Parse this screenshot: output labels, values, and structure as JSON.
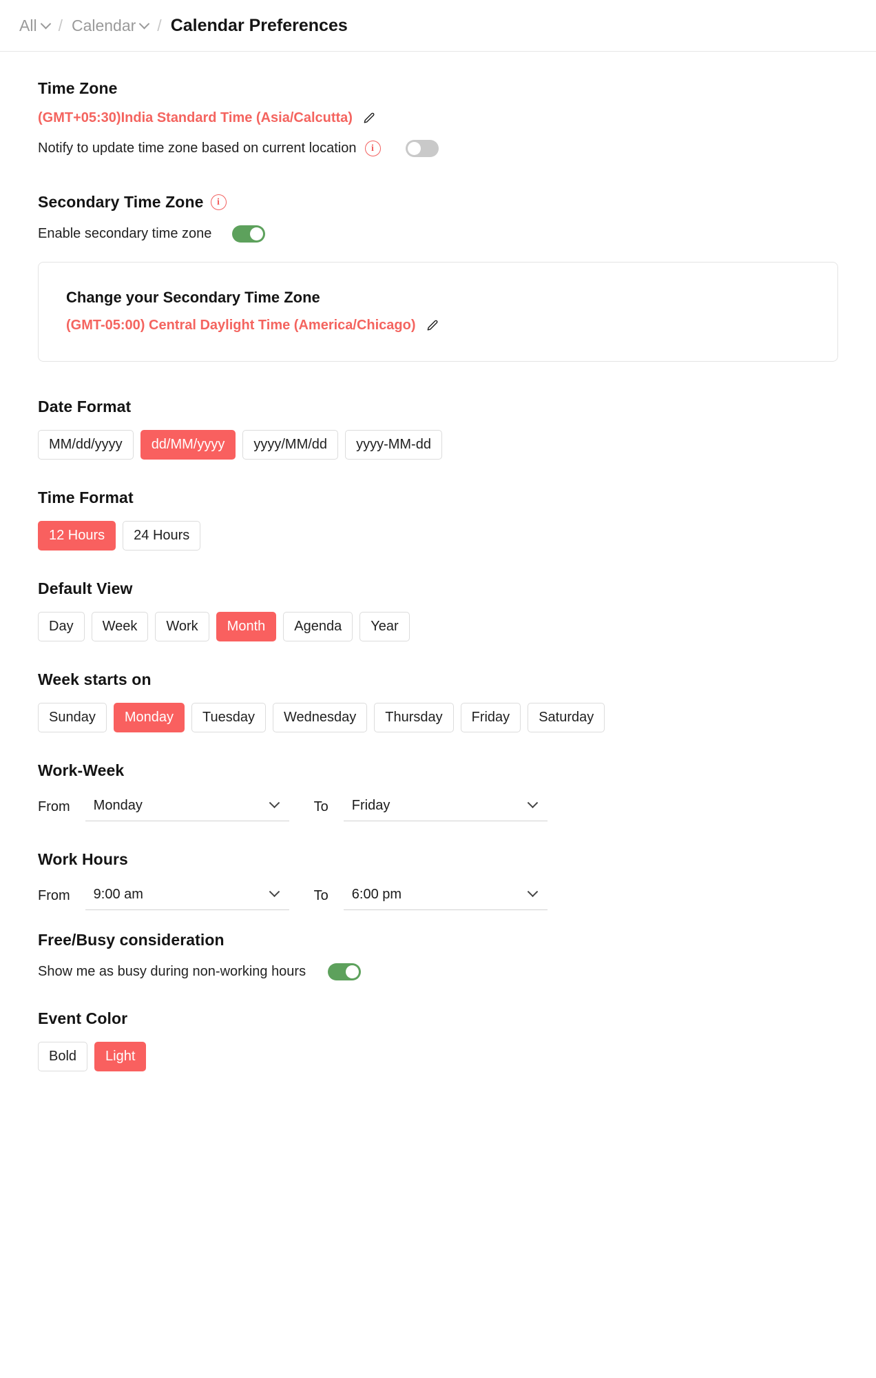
{
  "breadcrumb": {
    "items": [
      {
        "label": "All",
        "has_chevron": true,
        "active": false
      },
      {
        "label": "Calendar",
        "has_chevron": true,
        "active": false
      },
      {
        "label": "Calendar Preferences",
        "has_chevron": false,
        "active": true
      }
    ],
    "separator": "/"
  },
  "colors": {
    "accent_red": "#f9605f",
    "toggle_on_green": "#5da15c",
    "toggle_off_gray": "#c9c9c9",
    "text_dark": "#141414",
    "muted": "#9a9a9a"
  },
  "time_zone": {
    "title": "Time Zone",
    "value": "(GMT+05:30)India Standard Time (Asia/Calcutta)",
    "edit_icon": "pencil-icon",
    "notify": {
      "label": "Notify to update time zone based on current location",
      "info_icon": "info-icon",
      "toggle_state": "off"
    }
  },
  "secondary_time_zone": {
    "title": "Secondary Time Zone",
    "info_icon": "info-icon",
    "enable": {
      "label": "Enable secondary time zone",
      "toggle_state": "on"
    },
    "card": {
      "title": "Change your Secondary Time Zone",
      "value": "(GMT-05:00) Central Daylight Time (America/Chicago)",
      "edit_icon": "pencil-icon"
    }
  },
  "date_format": {
    "title": "Date Format",
    "options": [
      "MM/dd/yyyy",
      "dd/MM/yyyy",
      "yyyy/MM/dd",
      "yyyy-MM-dd"
    ],
    "selected": "dd/MM/yyyy"
  },
  "time_format": {
    "title": "Time Format",
    "options": [
      "12 Hours",
      "24 Hours"
    ],
    "selected": "12 Hours"
  },
  "default_view": {
    "title": "Default View",
    "options": [
      "Day",
      "Week",
      "Work",
      "Month",
      "Agenda",
      "Year"
    ],
    "selected": "Month"
  },
  "week_starts_on": {
    "title": "Week starts on",
    "options": [
      "Sunday",
      "Monday",
      "Tuesday",
      "Wednesday",
      "Thursday",
      "Friday",
      "Saturday"
    ],
    "selected": "Monday"
  },
  "work_week": {
    "title": "Work-Week",
    "from_label": "From",
    "from_value": "Monday",
    "to_label": "To",
    "to_value": "Friday"
  },
  "work_hours": {
    "title": "Work Hours",
    "from_label": "From",
    "from_value": "9:00 am",
    "to_label": "To",
    "to_value": "6:00 pm"
  },
  "free_busy": {
    "title": "Free/Busy consideration",
    "label": "Show me as busy during non-working hours",
    "toggle_state": "on"
  },
  "event_color": {
    "title": "Event Color",
    "options": [
      "Bold",
      "Light"
    ],
    "selected": "Light"
  }
}
